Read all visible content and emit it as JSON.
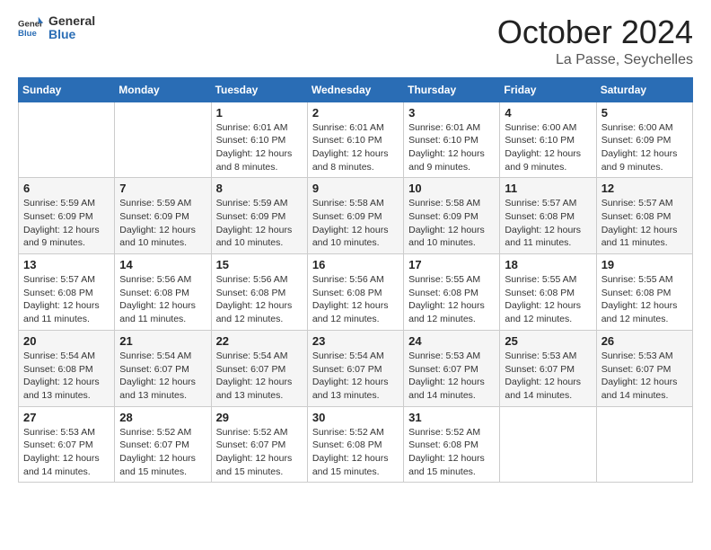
{
  "header": {
    "logo_general": "General",
    "logo_blue": "Blue",
    "month": "October 2024",
    "location": "La Passe, Seychelles"
  },
  "weekdays": [
    "Sunday",
    "Monday",
    "Tuesday",
    "Wednesday",
    "Thursday",
    "Friday",
    "Saturday"
  ],
  "weeks": [
    [
      {
        "day": "",
        "sunrise": "",
        "sunset": "",
        "daylight": ""
      },
      {
        "day": "",
        "sunrise": "",
        "sunset": "",
        "daylight": ""
      },
      {
        "day": "1",
        "sunrise": "Sunrise: 6:01 AM",
        "sunset": "Sunset: 6:10 PM",
        "daylight": "Daylight: 12 hours and 8 minutes."
      },
      {
        "day": "2",
        "sunrise": "Sunrise: 6:01 AM",
        "sunset": "Sunset: 6:10 PM",
        "daylight": "Daylight: 12 hours and 8 minutes."
      },
      {
        "day": "3",
        "sunrise": "Sunrise: 6:01 AM",
        "sunset": "Sunset: 6:10 PM",
        "daylight": "Daylight: 12 hours and 9 minutes."
      },
      {
        "day": "4",
        "sunrise": "Sunrise: 6:00 AM",
        "sunset": "Sunset: 6:10 PM",
        "daylight": "Daylight: 12 hours and 9 minutes."
      },
      {
        "day": "5",
        "sunrise": "Sunrise: 6:00 AM",
        "sunset": "Sunset: 6:09 PM",
        "daylight": "Daylight: 12 hours and 9 minutes."
      }
    ],
    [
      {
        "day": "6",
        "sunrise": "Sunrise: 5:59 AM",
        "sunset": "Sunset: 6:09 PM",
        "daylight": "Daylight: 12 hours and 9 minutes."
      },
      {
        "day": "7",
        "sunrise": "Sunrise: 5:59 AM",
        "sunset": "Sunset: 6:09 PM",
        "daylight": "Daylight: 12 hours and 10 minutes."
      },
      {
        "day": "8",
        "sunrise": "Sunrise: 5:59 AM",
        "sunset": "Sunset: 6:09 PM",
        "daylight": "Daylight: 12 hours and 10 minutes."
      },
      {
        "day": "9",
        "sunrise": "Sunrise: 5:58 AM",
        "sunset": "Sunset: 6:09 PM",
        "daylight": "Daylight: 12 hours and 10 minutes."
      },
      {
        "day": "10",
        "sunrise": "Sunrise: 5:58 AM",
        "sunset": "Sunset: 6:09 PM",
        "daylight": "Daylight: 12 hours and 10 minutes."
      },
      {
        "day": "11",
        "sunrise": "Sunrise: 5:57 AM",
        "sunset": "Sunset: 6:08 PM",
        "daylight": "Daylight: 12 hours and 11 minutes."
      },
      {
        "day": "12",
        "sunrise": "Sunrise: 5:57 AM",
        "sunset": "Sunset: 6:08 PM",
        "daylight": "Daylight: 12 hours and 11 minutes."
      }
    ],
    [
      {
        "day": "13",
        "sunrise": "Sunrise: 5:57 AM",
        "sunset": "Sunset: 6:08 PM",
        "daylight": "Daylight: 12 hours and 11 minutes."
      },
      {
        "day": "14",
        "sunrise": "Sunrise: 5:56 AM",
        "sunset": "Sunset: 6:08 PM",
        "daylight": "Daylight: 12 hours and 11 minutes."
      },
      {
        "day": "15",
        "sunrise": "Sunrise: 5:56 AM",
        "sunset": "Sunset: 6:08 PM",
        "daylight": "Daylight: 12 hours and 12 minutes."
      },
      {
        "day": "16",
        "sunrise": "Sunrise: 5:56 AM",
        "sunset": "Sunset: 6:08 PM",
        "daylight": "Daylight: 12 hours and 12 minutes."
      },
      {
        "day": "17",
        "sunrise": "Sunrise: 5:55 AM",
        "sunset": "Sunset: 6:08 PM",
        "daylight": "Daylight: 12 hours and 12 minutes."
      },
      {
        "day": "18",
        "sunrise": "Sunrise: 5:55 AM",
        "sunset": "Sunset: 6:08 PM",
        "daylight": "Daylight: 12 hours and 12 minutes."
      },
      {
        "day": "19",
        "sunrise": "Sunrise: 5:55 AM",
        "sunset": "Sunset: 6:08 PM",
        "daylight": "Daylight: 12 hours and 12 minutes."
      }
    ],
    [
      {
        "day": "20",
        "sunrise": "Sunrise: 5:54 AM",
        "sunset": "Sunset: 6:08 PM",
        "daylight": "Daylight: 12 hours and 13 minutes."
      },
      {
        "day": "21",
        "sunrise": "Sunrise: 5:54 AM",
        "sunset": "Sunset: 6:07 PM",
        "daylight": "Daylight: 12 hours and 13 minutes."
      },
      {
        "day": "22",
        "sunrise": "Sunrise: 5:54 AM",
        "sunset": "Sunset: 6:07 PM",
        "daylight": "Daylight: 12 hours and 13 minutes."
      },
      {
        "day": "23",
        "sunrise": "Sunrise: 5:54 AM",
        "sunset": "Sunset: 6:07 PM",
        "daylight": "Daylight: 12 hours and 13 minutes."
      },
      {
        "day": "24",
        "sunrise": "Sunrise: 5:53 AM",
        "sunset": "Sunset: 6:07 PM",
        "daylight": "Daylight: 12 hours and 14 minutes."
      },
      {
        "day": "25",
        "sunrise": "Sunrise: 5:53 AM",
        "sunset": "Sunset: 6:07 PM",
        "daylight": "Daylight: 12 hours and 14 minutes."
      },
      {
        "day": "26",
        "sunrise": "Sunrise: 5:53 AM",
        "sunset": "Sunset: 6:07 PM",
        "daylight": "Daylight: 12 hours and 14 minutes."
      }
    ],
    [
      {
        "day": "27",
        "sunrise": "Sunrise: 5:53 AM",
        "sunset": "Sunset: 6:07 PM",
        "daylight": "Daylight: 12 hours and 14 minutes."
      },
      {
        "day": "28",
        "sunrise": "Sunrise: 5:52 AM",
        "sunset": "Sunset: 6:07 PM",
        "daylight": "Daylight: 12 hours and 15 minutes."
      },
      {
        "day": "29",
        "sunrise": "Sunrise: 5:52 AM",
        "sunset": "Sunset: 6:07 PM",
        "daylight": "Daylight: 12 hours and 15 minutes."
      },
      {
        "day": "30",
        "sunrise": "Sunrise: 5:52 AM",
        "sunset": "Sunset: 6:08 PM",
        "daylight": "Daylight: 12 hours and 15 minutes."
      },
      {
        "day": "31",
        "sunrise": "Sunrise: 5:52 AM",
        "sunset": "Sunset: 6:08 PM",
        "daylight": "Daylight: 12 hours and 15 minutes."
      },
      {
        "day": "",
        "sunrise": "",
        "sunset": "",
        "daylight": ""
      },
      {
        "day": "",
        "sunrise": "",
        "sunset": "",
        "daylight": ""
      }
    ]
  ]
}
